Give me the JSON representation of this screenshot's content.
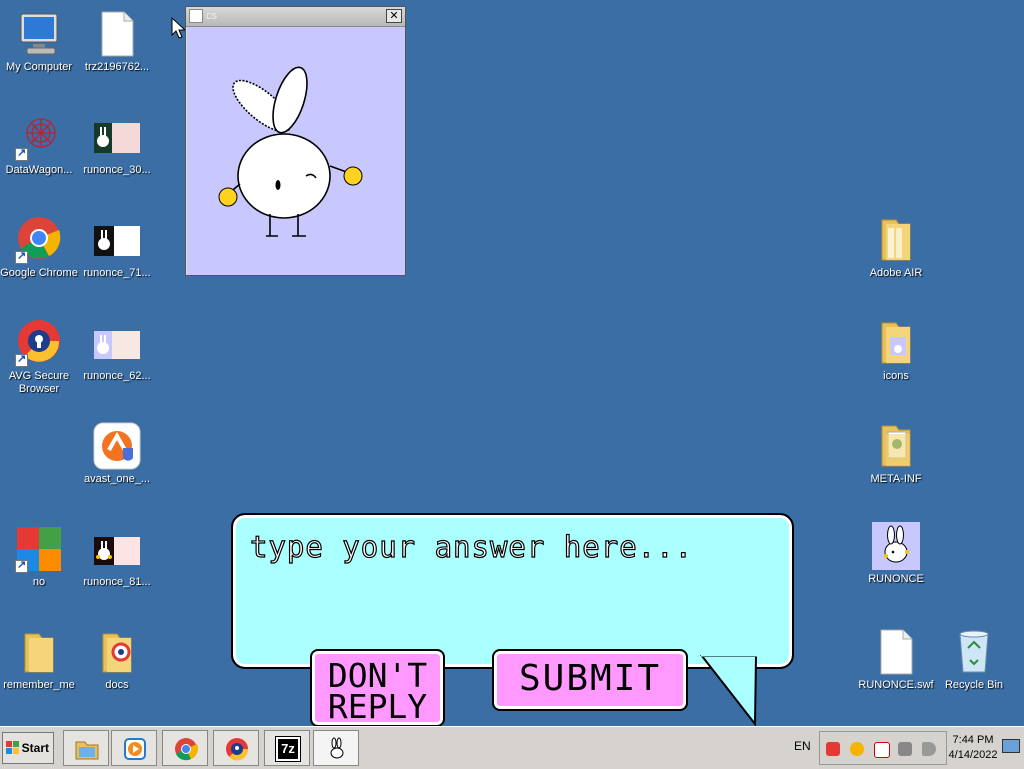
{
  "desktop": {
    "left_icons": [
      {
        "name": "my-computer-icon",
        "label": "My Computer"
      },
      {
        "name": "text-file-icon",
        "label": "trz2196762..."
      },
      {
        "name": "datawagon-icon",
        "label": "DataWagon..."
      },
      {
        "name": "image-file-icon",
        "label": "runonce_30..."
      },
      {
        "name": "google-chrome-icon",
        "label": "Google Chrome"
      },
      {
        "name": "image-file-icon",
        "label": "runonce_71..."
      },
      {
        "name": "avg-browser-icon",
        "label": "AVG Secure Browser"
      },
      {
        "name": "image-file-icon",
        "label": "runonce_62..."
      },
      {
        "name": "avast-icon",
        "label": "avast_one_..."
      },
      {
        "name": "avg-icon",
        "label": "no"
      },
      {
        "name": "image-file-icon",
        "label": "runonce_81..."
      },
      {
        "name": "folder-icon",
        "label": "remember_me"
      },
      {
        "name": "folder-icon",
        "label": "docs"
      }
    ],
    "right_icons": [
      {
        "name": "folder-icon",
        "label": "Adobe AIR"
      },
      {
        "name": "folder-icon",
        "label": "icons"
      },
      {
        "name": "folder-icon",
        "label": "META-INF"
      },
      {
        "name": "bunny-app-icon",
        "label": "RUNONCE"
      },
      {
        "name": "file-icon",
        "label": "RUNONCE.swf"
      },
      {
        "name": "recycle-bin-icon",
        "label": "Recycle Bin"
      }
    ]
  },
  "window": {
    "title": "cs",
    "close_label": "✕"
  },
  "game": {
    "prompt": "type your answer here...",
    "dont_reply_line1": "DON'T",
    "dont_reply_line2": "REPLY",
    "submit_label": "SUBMIT"
  },
  "taskbar": {
    "start_label": "Start",
    "apps": [
      "file-explorer-icon",
      "media-player-icon",
      "google-chrome-icon",
      "avg-browser-icon",
      "7zip-icon",
      "bunny-app-icon"
    ],
    "seven_zip_label": "7z",
    "language": "EN",
    "time": "7:44 PM",
    "date": "4/14/2022"
  },
  "colors": {
    "desktop": "#3a6ea5",
    "bubble": "#aaffff",
    "button": "#ff99ff",
    "window_bg": "#c8c8ff"
  }
}
